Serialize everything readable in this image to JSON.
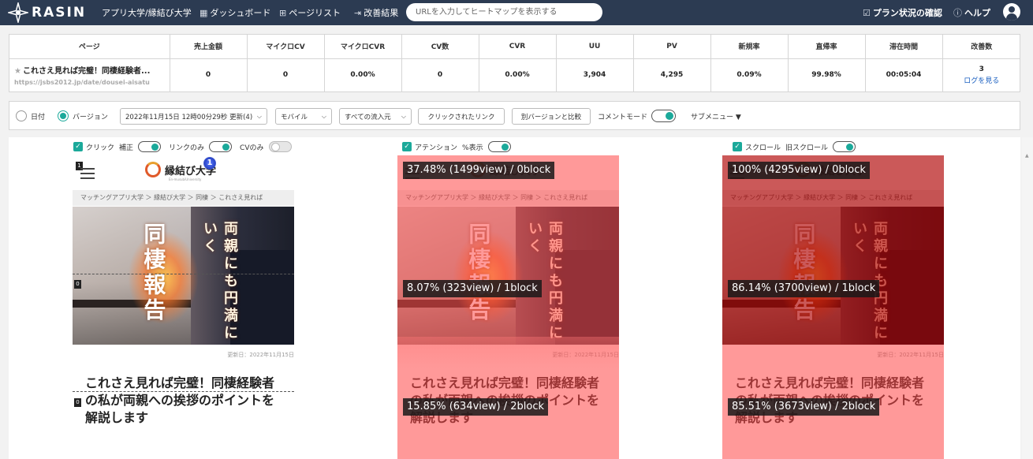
{
  "topbar": {
    "logo_text": "RASIN",
    "site_name": "アプリ大学/縁結び大学",
    "dashboard": "ダッシュボード",
    "page_list": "ページリスト",
    "improvements": "改善結果",
    "url_placeholder": "URLを入力してヒートマップを表示する",
    "plan_status": "プラン状況の確認",
    "help": "ヘルプ"
  },
  "metrics": {
    "headers": [
      "ページ",
      "売上金額",
      "マイクロCV",
      "マイクロCVR",
      "CV数",
      "CVR",
      "UU",
      "PV",
      "新規率",
      "直帰率",
      "滞在時間",
      "改善数"
    ],
    "page_title": "これさえ見れば完璧！同棲経験者...",
    "page_url": "https://jsbs2012.jp/date/dousei-aisatu",
    "values": [
      "0",
      "0",
      "0.00%",
      "0",
      "0.00%",
      "3,904",
      "4,295",
      "0.09%",
      "99.98%",
      "00:05:04",
      "3"
    ],
    "log_link": "ログを見る"
  },
  "controls": {
    "date_label": "日付",
    "version_label": "バージョン",
    "version_select": "2022年11月15日 12時00分29秒 更新(4)",
    "device_select": "モバイル",
    "source_select": "すべての流入元",
    "clicked_links_button": "クリックされたリンク",
    "compare_button": "別バージョンと比較",
    "comment_mode_label": "コメントモード",
    "submenu": "サブメニュー ▼"
  },
  "panels": {
    "click": {
      "check_label": "クリック",
      "adjust_label": "補正",
      "links_only": "リンクのみ",
      "cv_only": "CVのみ"
    },
    "attention": {
      "check_label": "アテンション",
      "percent_label": "%表示"
    },
    "scroll": {
      "check_label": "スクロール",
      "old_label": "旧スクロール"
    }
  },
  "page_preview": {
    "brand": "縁結び大学",
    "brand_sub": "En-musubiUniversity",
    "breadcrumb": "マッチングアプリ大学 ＞ 縁結び大学 ＞ 同棲 ＞ これさえ見れば",
    "hero_big": "同棲報告",
    "hero_small": "両親にも円満にいく",
    "date": "更新日：2022年11月15日",
    "title": "これさえ見れば完璧！同棲経験者の私が両親への挨拶のポイントを解説します",
    "click_badge": "1",
    "menu_marker": "1",
    "marker_0": "0"
  },
  "attention_tags": [
    "37.48% (1499view) / 0block",
    "8.07% (323view) / 1block",
    "15.85% (634view) / 2block"
  ],
  "scroll_tags": [
    "100% (4295view) / 0block",
    "86.14% (3700view) / 1block",
    "85.51% (3673view) / 2block"
  ],
  "colors": {
    "accent": "#1ba99a",
    "nav_bg": "#2c3b52",
    "overlay_red": "#ff5a5a",
    "overlay_dark": "#9c0a0a"
  }
}
